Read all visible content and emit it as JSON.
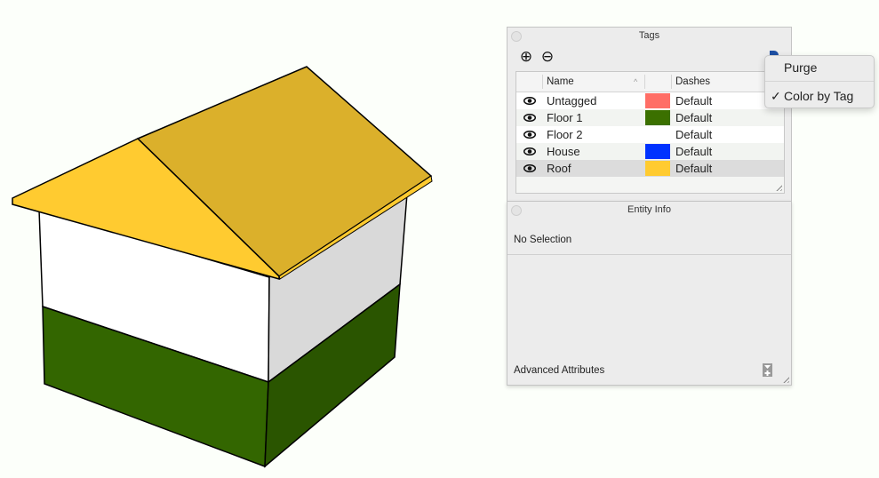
{
  "viewport": {
    "model": "house",
    "colors": {
      "roof_left": "#ffcb30",
      "roof_right": "#dbb02b",
      "wall_front_upper": "#ffffff",
      "wall_side_upper": "#d9d9d9",
      "wall_front_lower": "#336600",
      "wall_side_lower": "#2a5500",
      "edge": "#000000",
      "background": "#fcfffa"
    }
  },
  "tags_panel": {
    "title": "Tags",
    "add_icon": "⊕",
    "remove_icon": "⊖",
    "columns": {
      "name": "Name",
      "sort_indicator": "^",
      "dashes": "Dashes"
    },
    "rows": [
      {
        "name": "Untagged",
        "color": "#ff6e66",
        "dashes": "Default",
        "visible": true,
        "selected": false
      },
      {
        "name": "Floor 1",
        "color": "#3b7000",
        "dashes": "Default",
        "visible": true,
        "selected": false
      },
      {
        "name": "Floor 2",
        "color": "",
        "dashes": "Default",
        "visible": true,
        "selected": false
      },
      {
        "name": "House",
        "color": "#0032ff",
        "dashes": "Default",
        "visible": true,
        "selected": false
      },
      {
        "name": "Roof",
        "color": "#ffcb30",
        "dashes": "Default",
        "visible": true,
        "selected": true
      }
    ]
  },
  "details_menu": {
    "items": [
      {
        "label": "Purge",
        "checked": false
      },
      {
        "label": "Color by Tag",
        "checked": true,
        "check_mark": "✓"
      }
    ]
  },
  "entity_panel": {
    "title": "Entity Info",
    "status": "No Selection",
    "advanced_label": "Advanced Attributes"
  }
}
